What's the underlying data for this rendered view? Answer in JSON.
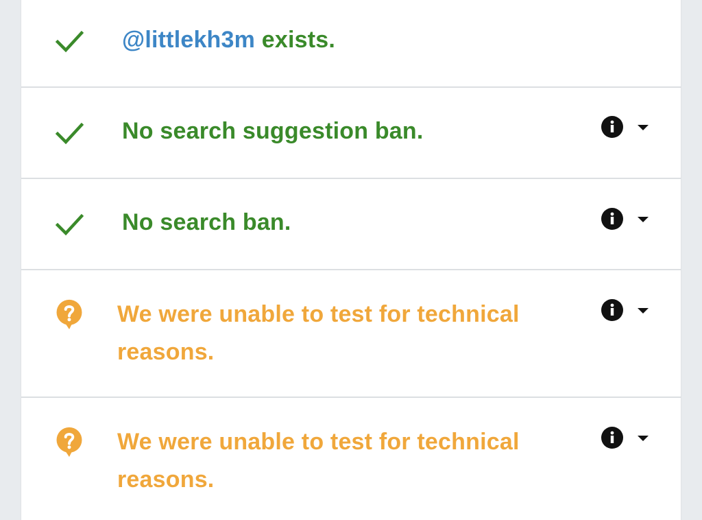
{
  "colors": {
    "ok": "#3a8a2a",
    "warn": "#f0a73b",
    "handle": "#3d86c6",
    "info": "#111111"
  },
  "results": {
    "exists": {
      "icon": "check-icon",
      "handle": "@littlekh3m",
      "text": " exists."
    },
    "suggestion_ban": {
      "icon": "check-icon",
      "text": "No search suggestion ban.",
      "info_icon": "info-icon",
      "toggle_icon": "chevron-down-icon"
    },
    "search_ban": {
      "icon": "check-icon",
      "text": "No search ban.",
      "info_icon": "info-icon",
      "toggle_icon": "chevron-down-icon"
    },
    "test_one": {
      "icon": "question-bubble-icon",
      "text": "We were unable to test for technical reasons.",
      "info_icon": "info-icon",
      "toggle_icon": "chevron-down-icon"
    },
    "test_two": {
      "icon": "question-bubble-icon",
      "text": "We were unable to test for technical reasons.",
      "info_icon": "info-icon",
      "toggle_icon": "chevron-down-icon"
    }
  }
}
